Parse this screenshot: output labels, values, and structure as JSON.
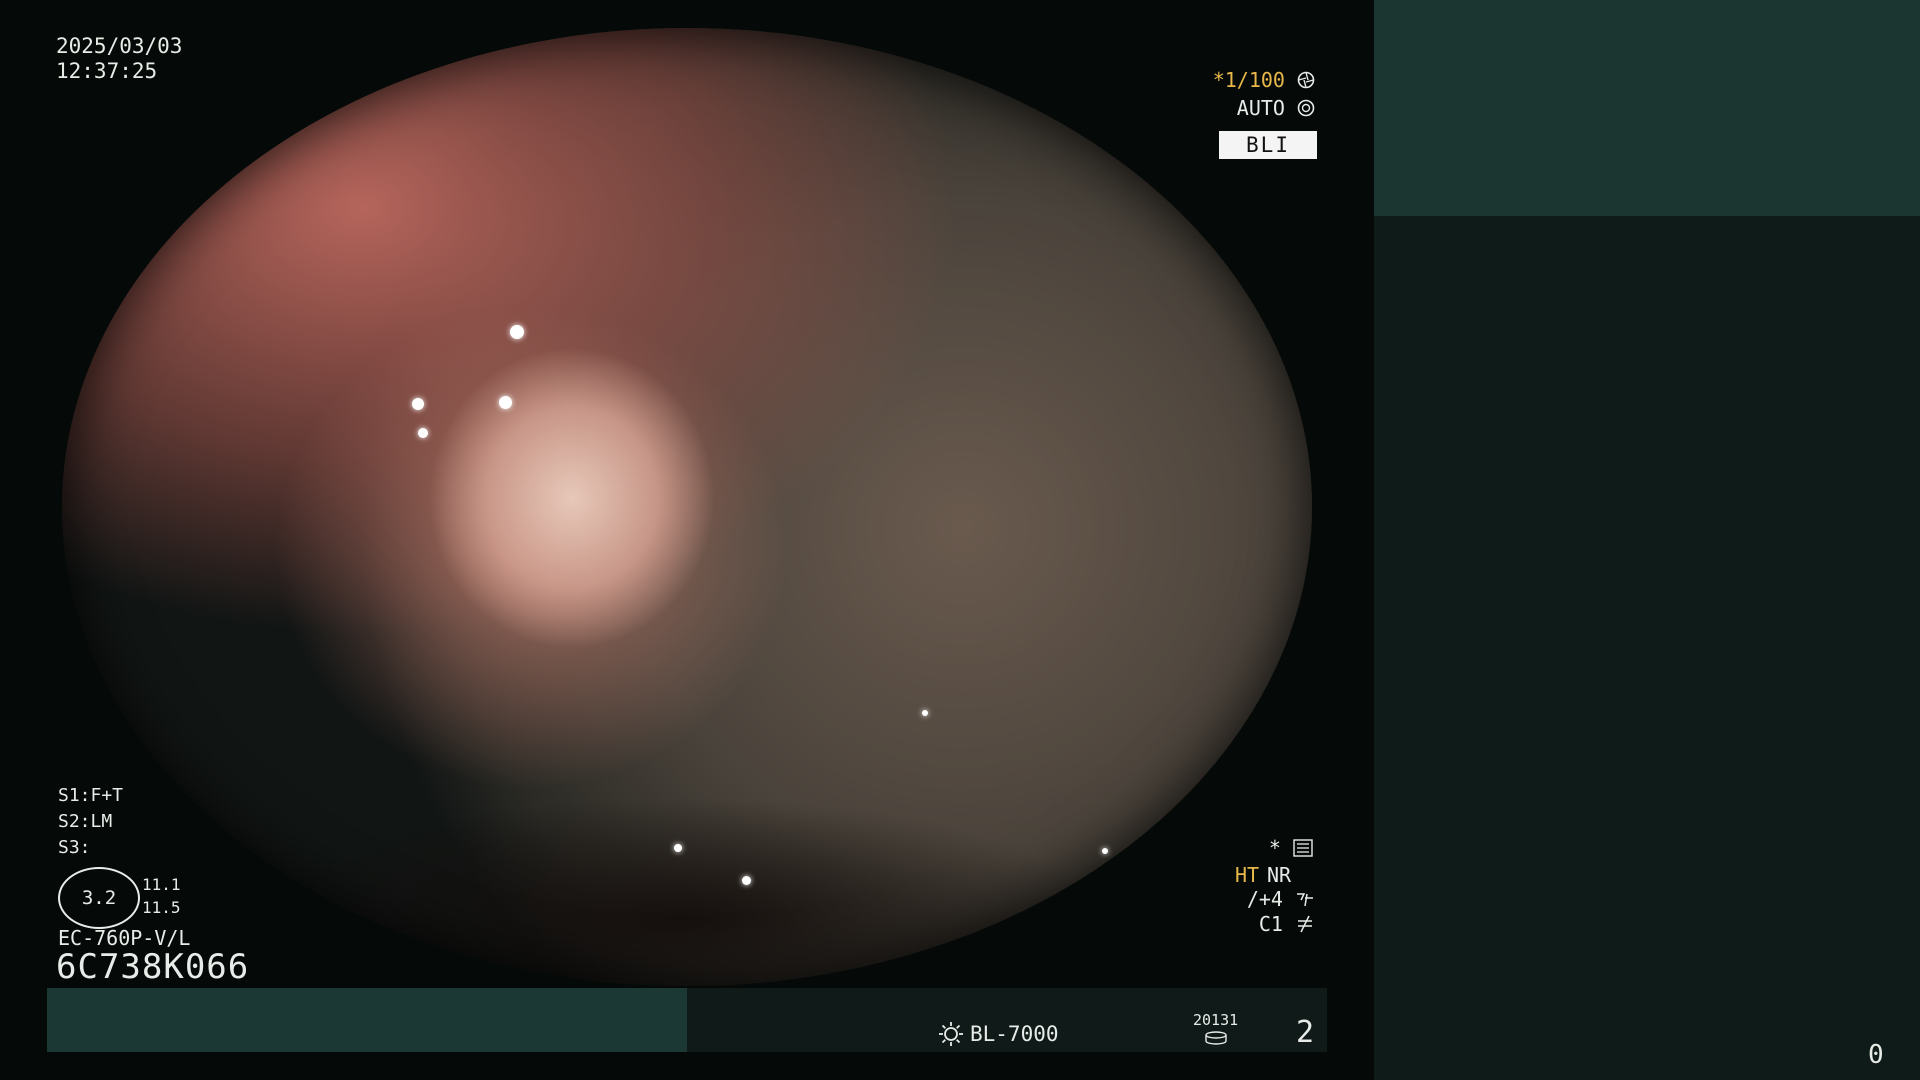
{
  "overlay": {
    "date": "2025/03/03",
    "time": "12:37:25",
    "shutter": "*1/100",
    "iris_mode": "AUTO",
    "mode_label": "BLI",
    "s1": "S1:F+T",
    "s2": "S2:LM",
    "s3": "S3:",
    "zoom_value": "3.2",
    "zoom_line1": "11.1",
    "zoom_line2": "11.5",
    "scope_model": "EC-760P-V/L",
    "scope_serial": "6C738K066",
    "settings_star": "*",
    "ht_label": "HT",
    "nr_label": "NR",
    "enhance": "/+4",
    "color_mode": "C1",
    "light_source": "BL-7000",
    "counter": "20131",
    "page_number": "2",
    "corner_number": "0"
  },
  "colors": {
    "accent_orange": "#e8b84a",
    "text": "#e8ece8",
    "panel_teal": "#1b3530",
    "panel_dark": "#0f1b18",
    "bar_teal": "#1c3834"
  },
  "icons": [
    "aperture-icon",
    "auto-iris-icon",
    "settings-list-icon",
    "enhance-icon",
    "color-icon",
    "lamp-icon",
    "disk-icon"
  ]
}
